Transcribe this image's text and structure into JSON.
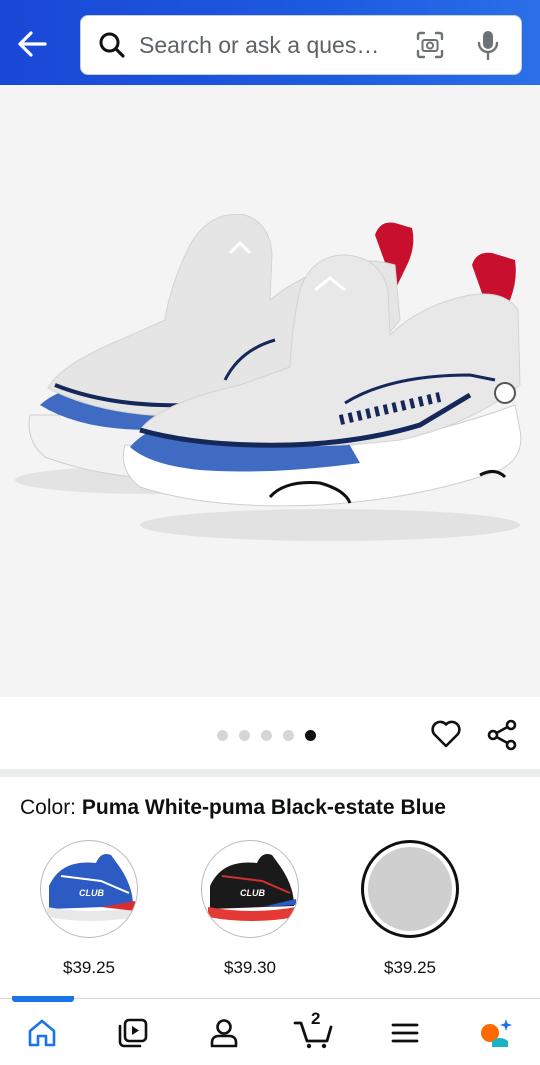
{
  "header": {
    "search_placeholder": "Search or ask a ques…"
  },
  "carousel": {
    "total_images": 5,
    "active_index": 4
  },
  "product": {
    "color_label": "Color: ",
    "color_value": "Puma White-puma Black-estate Blue"
  },
  "variants": [
    {
      "price": "$39.25",
      "selected": false
    },
    {
      "price": "$39.30",
      "selected": false
    },
    {
      "price": "$39.25",
      "selected": true
    }
  ],
  "bottom_nav": {
    "cart_count": "2",
    "active_tab": "home"
  },
  "colors": {
    "header_blue": "#1a48d6",
    "nav_active": "#1a73e8",
    "text": "#0f1111"
  }
}
